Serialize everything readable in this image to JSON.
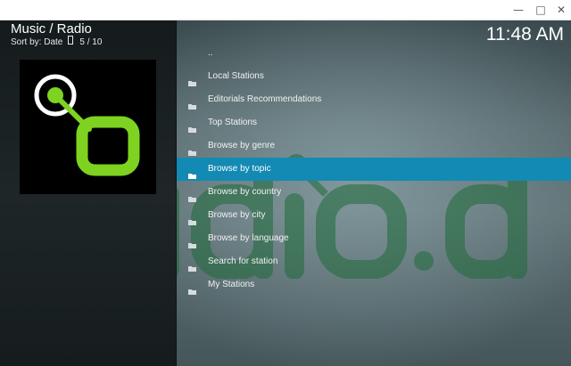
{
  "window": {
    "minimize_glyph": "—",
    "maximize_glyph": "□",
    "close_glyph": "✕"
  },
  "header": {
    "title": "Music / Radio",
    "sort_label": "Sort by: Date",
    "position": "5 / 10",
    "clock": "11:48 AM"
  },
  "watermark": {
    "text": "radio.de",
    "color": "#1f6b3a"
  },
  "thumbnail": {
    "icon": "radio-de-logo-icon",
    "accent": "#7ed321"
  },
  "list": {
    "selected_index": 5,
    "items": [
      {
        "label": "..",
        "icon": ""
      },
      {
        "label": "Local Stations",
        "icon": "folder-icon"
      },
      {
        "label": "Editorials Recommendations",
        "icon": "folder-icon"
      },
      {
        "label": "Top Stations",
        "icon": "folder-icon"
      },
      {
        "label": "Browse by genre",
        "icon": "folder-icon"
      },
      {
        "label": "Browse by topic",
        "icon": "folder-icon"
      },
      {
        "label": "Browse by country",
        "icon": "folder-icon"
      },
      {
        "label": "Browse by city",
        "icon": "folder-icon"
      },
      {
        "label": "Browse by language",
        "icon": "folder-icon"
      },
      {
        "label": "Search for station",
        "icon": "folder-icon"
      },
      {
        "label": "My Stations",
        "icon": "folder-icon"
      }
    ]
  },
  "colors": {
    "selection": "#138ab3",
    "text": "#f2f2f2"
  }
}
